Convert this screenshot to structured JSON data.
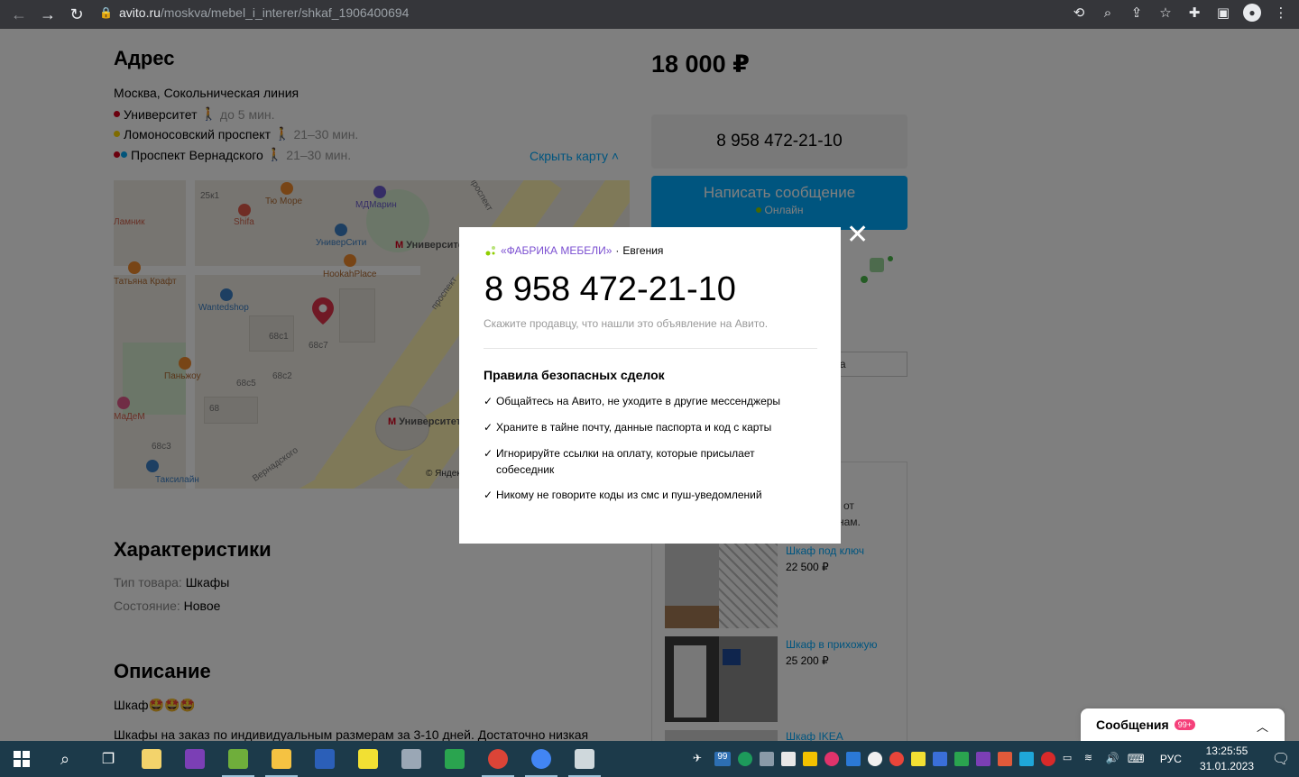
{
  "browser": {
    "url_host": "avito.ru",
    "url_path": "/moskva/mebel_i_interer/shkaf_1906400694"
  },
  "address": {
    "heading": "Адрес",
    "city": "Москва, Сокольническая линия",
    "stations": [
      {
        "name": "Университет",
        "time": "до 5 мин.",
        "color": "#d6001c"
      },
      {
        "name": "Ломоносовский проспект",
        "time": "21–30 мин.",
        "color": "#ffd700"
      },
      {
        "name": "Проспект Вернадского",
        "time": "21–30 мин.",
        "color": "#d6001c"
      }
    ],
    "hide_map": "Скрыть карту",
    "map_labels": {
      "l1": "Тю Море",
      "l2": "МДМарин",
      "l3": "УниверСити",
      "l4": "Университет",
      "l5": "HookahPlace",
      "l6": "Wantedshop",
      "l7": "Паньжоу",
      "l8": "Университет",
      "l9": "Таксилайн",
      "l10": "Shifa",
      "l11": "Ламник",
      "l12": "Татьяна Крафт",
      "l13": "МаДеМ",
      "b1": "68с1",
      "b2": "68с7",
      "b3": "68с2",
      "b4": "68с5",
      "b5": "68с3",
      "b6": "68",
      "b7": "25к1",
      "street1": "проспект",
      "street2": "Вернадского",
      "street3": "проспект",
      "copyright": "© Яндекс"
    }
  },
  "price": "18 000 ₽",
  "phone_button": "8 958 472-21-10",
  "message_button": {
    "label": "Написать сообщение",
    "status": "Онлайн"
  },
  "side_input_text": "ца",
  "characteristics": {
    "heading": "Характеристики",
    "rows": [
      {
        "key": "Тип товара:",
        "value": "Шкафы"
      },
      {
        "key": "Состояние:",
        "value": "Новое"
      }
    ]
  },
  "description": {
    "heading": "Описание",
    "line1": "Шкаф🤩🤩🤩",
    "line2": "Шкафы на заказ по индивидуальным размерам за 3-10 дней. Достаточно низкая"
  },
  "recommendations": {
    "text1": "от",
    "text2": "нам.",
    "items": [
      {
        "title": "Шкаф под ключ",
        "price": "22 500 ₽"
      },
      {
        "title": "Шкаф в прихожую",
        "price": "25 200 ₽"
      },
      {
        "title": "Шкаф IKEA",
        "price": ""
      }
    ]
  },
  "messages_bar": {
    "label": "Сообщения",
    "badge": "99+"
  },
  "modal": {
    "shop": "«ФАБРИКА МЕБЕЛИ»",
    "separator": "·",
    "contact": "Евгения",
    "phone": "8 958 472-21-10",
    "hint": "Скажите продавцу, что нашли это объявление на Авито.",
    "rules_title": "Правила безопасных сделок",
    "rules": [
      "Общайтесь на Авито, не уходите в другие мессенджеры",
      "Храните в тайне почту, данные паспорта и код с карты",
      "Игнорируйте ссылки на оплату, которые присылает собеседник",
      "Никому не говорите коды из смс и пуш-уведомлений"
    ]
  },
  "taskbar": {
    "lang": "РУС",
    "time": "13:25:55",
    "date": "31.01.2023",
    "tray_badge": "99"
  },
  "colors": {
    "accent": "#00aaff",
    "shop": "#7b4fd1",
    "taskbar": "#1c3a4a"
  }
}
